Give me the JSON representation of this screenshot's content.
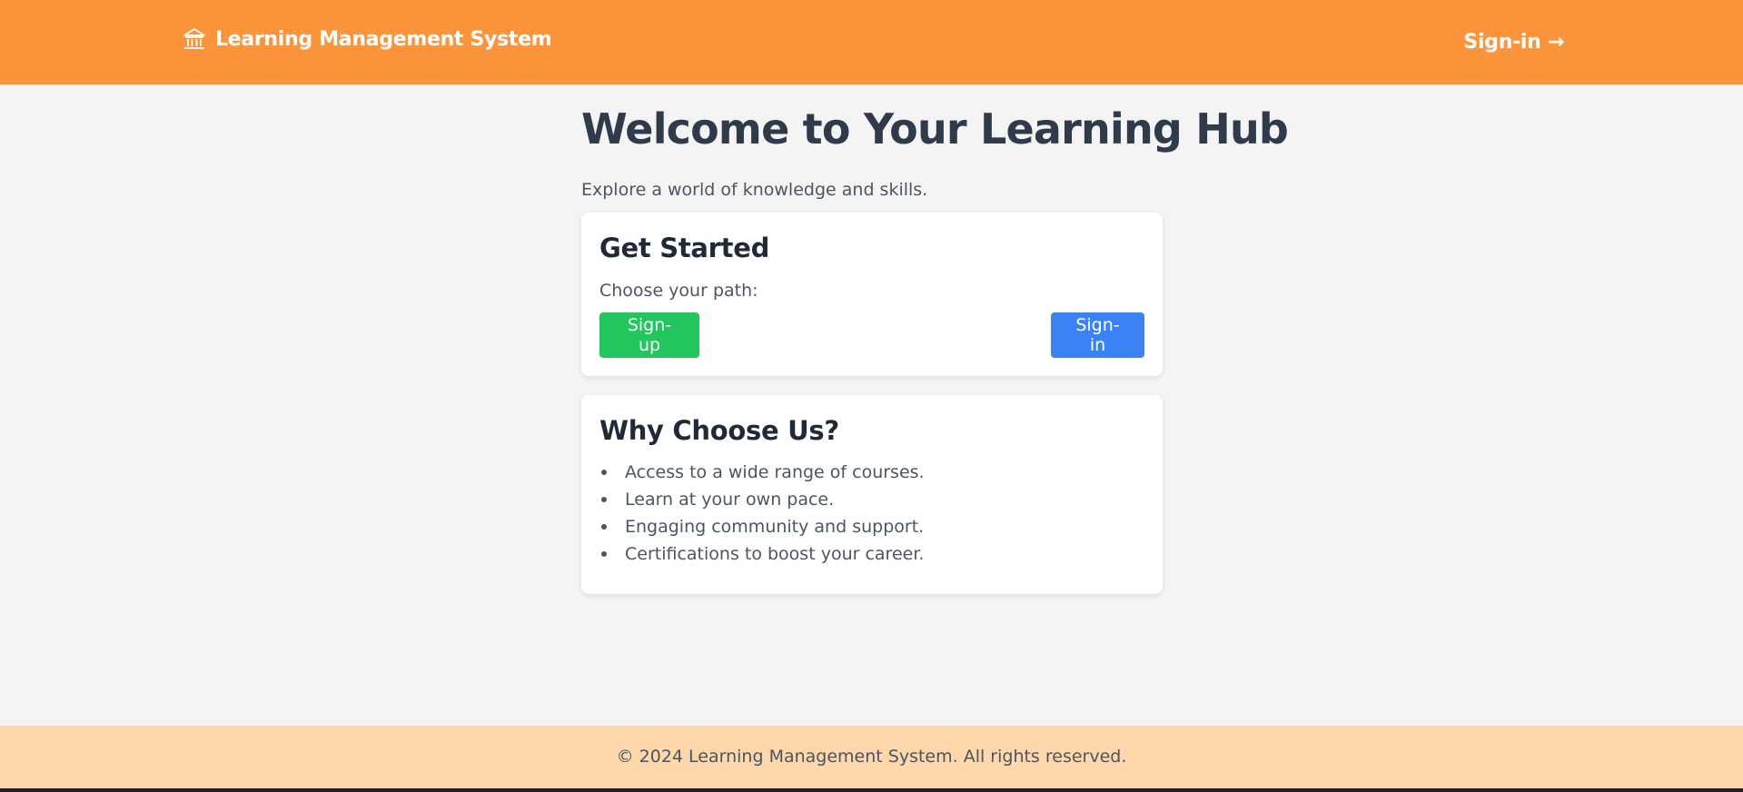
{
  "header": {
    "brand_icon": "institution-icon",
    "brand_label": "Learning Management System",
    "signin_link": "Sign-in →"
  },
  "hero": {
    "title": "Welcome to Your Learning Hub",
    "subtitle": "Explore a world of knowledge and skills."
  },
  "get_started": {
    "title": "Get Started",
    "prompt": "Choose your path:",
    "signup_label": "Sign-up",
    "signin_label": "Sign-in"
  },
  "why_choose": {
    "title": "Why Choose Us?",
    "items": [
      "Access to a wide range of courses.",
      "Learn at your own pace.",
      "Engaging community and support.",
      "Certifications to boost your career."
    ]
  },
  "footer": {
    "text": "© 2024 Learning Management System. All rights reserved."
  },
  "colors": {
    "header_bg": "#fc943c",
    "signup_button": "#22c55e",
    "signin_button": "#3b82f6",
    "footer_bg": "#fed7aa"
  }
}
